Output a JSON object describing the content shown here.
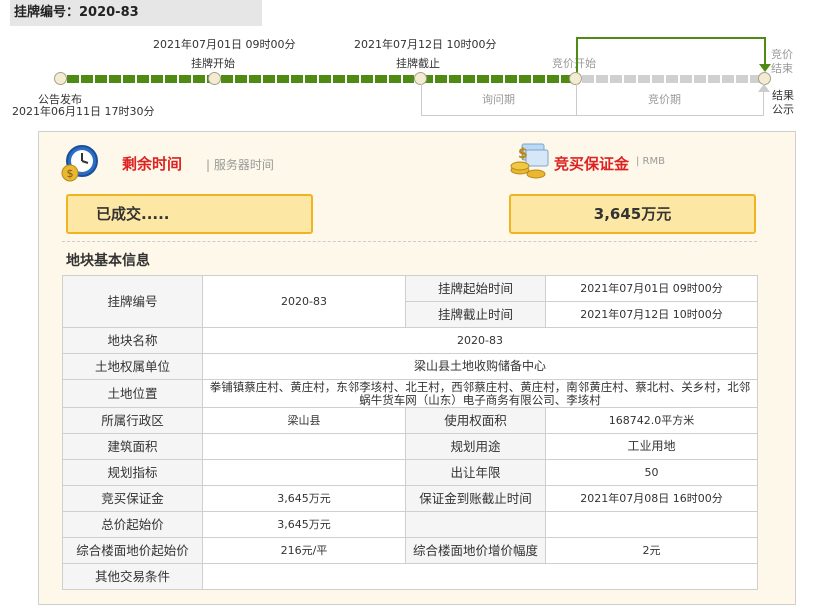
{
  "header": {
    "title": "挂牌编号：2020-83"
  },
  "timeline": {
    "announce": {
      "label": "公告发布",
      "time": "2021年06月11日 17时30分"
    },
    "listing_start": {
      "time": "2021年07月01日 09时00分",
      "label": "挂牌开始"
    },
    "listing_end": {
      "time": "2021年07月12日 10时00分",
      "label": "挂牌截止"
    },
    "bid_start": {
      "label": "竞价开始"
    },
    "bid_end": {
      "label_1": "竞价",
      "label_2": "结束"
    },
    "result": {
      "label_1": "结果",
      "label_2": "公示"
    },
    "period_inquiry": "询问期",
    "period_bidding": "竞价期",
    "colors": {
      "progress": "#4e8a14",
      "pending": "#d0d0d0"
    }
  },
  "remaining": {
    "title": "剩余时间",
    "subtitle": "| 服务器时间",
    "value": "已成交....."
  },
  "deposit": {
    "title": "竞买保证金",
    "subtitle": "| RMB",
    "value": "3,645万元"
  },
  "section_title": "地块基本信息",
  "table": {
    "listing_no_label": "挂牌编号",
    "listing_no": "2020-83",
    "start_time_label": "挂牌起始时间",
    "start_time": "2021年07月01日 09时00分",
    "end_time_label": "挂牌截止时间",
    "end_time": "2021年07月12日 10时00分",
    "parcel_name_label": "地块名称",
    "parcel_name": "2020-83",
    "owner_label": "土地权属单位",
    "owner": "梁山县土地收购储备中心",
    "location_label": "土地位置",
    "location": "拳铺镇蔡庄村、黄庄村，东邻李垓村、北王村，西邻蔡庄村、黄庄村，南邻黄庄村、蔡北村、关乡村，北邻蜗牛货车网（山东）电子商务有限公司、李垓村",
    "district_label": "所属行政区",
    "district": "梁山县",
    "use_area_label": "使用权面积",
    "use_area": "168742.0平方米",
    "building_area_label": "建筑面积",
    "building_area": "",
    "planned_use_label": "规划用途",
    "planned_use": "工业用地",
    "planning_index_label": "规划指标",
    "planning_index": "",
    "transfer_years_label": "出让年限",
    "transfer_years": "50",
    "deposit_label": "竞买保证金",
    "deposit": "3,645万元",
    "deposit_deadline_label": "保证金到账截止时间",
    "deposit_deadline": "2021年07月08日 16时00分",
    "start_price_label": "总价起始价",
    "start_price": "3,645万元",
    "floor_price_label": "综合楼面地价起始价",
    "floor_price": "216元/平",
    "increment_label": "综合楼面地价增价幅度",
    "increment": "2元",
    "other_label": "其他交易条件",
    "other": ""
  }
}
